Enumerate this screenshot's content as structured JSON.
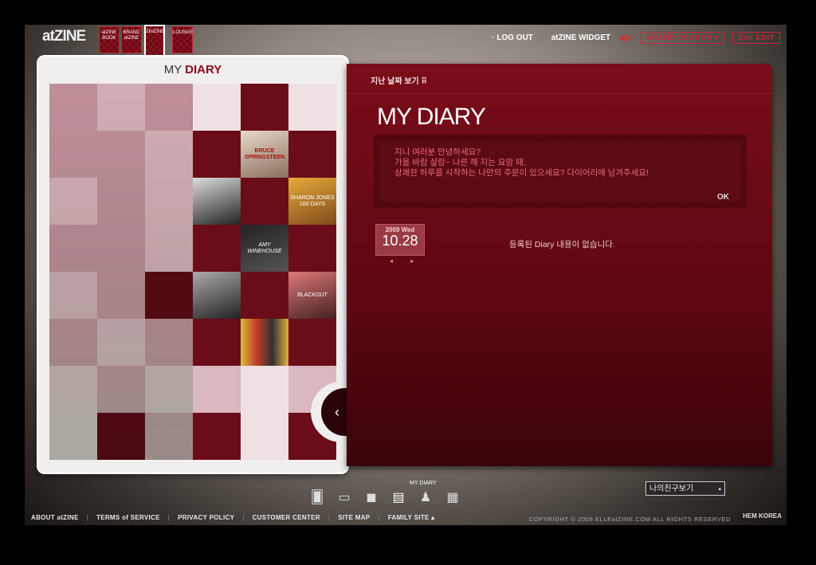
{
  "header": {
    "logo": "atZINE",
    "logo_small": "",
    "tabs": [
      {
        "label": "atZINE BOOK"
      },
      {
        "label": "BRAND atZINE"
      },
      {
        "label": "ZiniZINE"
      },
      {
        "label": "LOUNGE"
      }
    ],
    "logout": "· LOG OUT",
    "widget": "atZINE WIDGET",
    "brand_search": "BRAND SEARCH ▾",
    "zini_edit": "Zini EDIT"
  },
  "left_panel": {
    "title_a": "MY",
    "title_b": "DIARY",
    "albums": [
      "BRUCE SPRINGSTEEN",
      "",
      "SHARON JONES 100 DAYS",
      "AMY WINEHOUSE",
      "",
      "BLACKOUT",
      ""
    ]
  },
  "right_panel": {
    "past_dates": "지난 날짜 보기 ⠿",
    "title": "MY DIARY",
    "message_lines": [
      "지니 여러분 안녕하세요?",
      "가을 바람 살랑~ 나른 해 지는 요맘 때,",
      "상쾌한 하루를 시작하는 나만의 주문이 있으세요? 다이어리에 남겨주세요!"
    ],
    "ok": "OK",
    "date_year": "2009  Wed",
    "date_day": "10.28",
    "date_nav": "◂ ▸",
    "empty_message": "등록된 Diary 내용이 없습니다."
  },
  "bottom": {
    "active_label": "MY DIARY",
    "friend_select": "나의친구보기"
  },
  "footer": {
    "links": [
      "ABOUT atZINE",
      "TERMS of SERVICE",
      "PRIVACY POLICY",
      "CUSTOMER CENTER",
      "SITE MAP",
      "FAMILY SITE ▴"
    ],
    "copyright": "COPYRIGHT © 2009 ELLEatZINE.COM ALL RIGHTS RESERVED",
    "company": "HEM KOREA"
  },
  "colors": {
    "accent": "#8a1020",
    "panel": "#6a0d19"
  }
}
